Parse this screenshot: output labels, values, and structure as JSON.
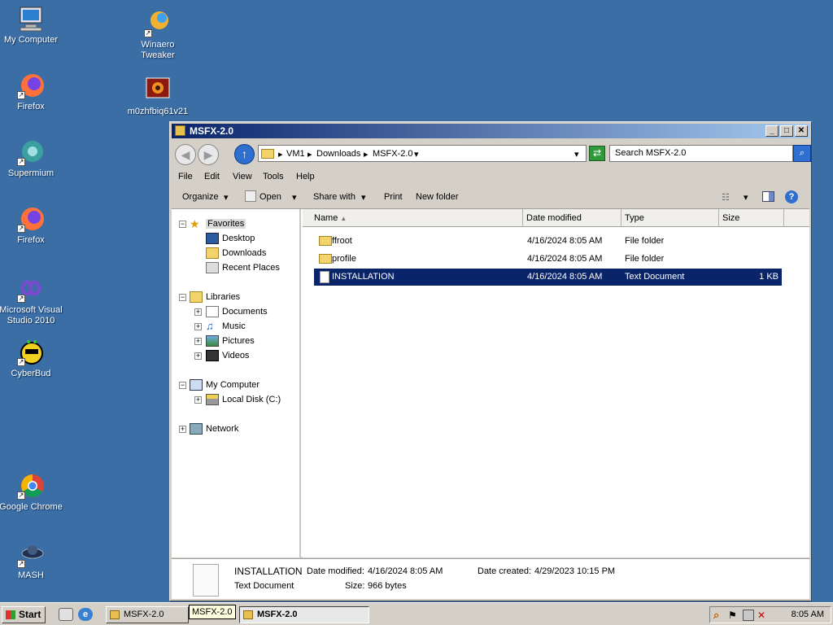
{
  "desktop": {
    "icons": [
      {
        "label": "My Computer"
      },
      {
        "label": "Winaero Tweaker"
      },
      {
        "label": "Firefox"
      },
      {
        "label": "m0zhfbiq61v21"
      },
      {
        "label": "Supermium"
      },
      {
        "label": "Firefox"
      },
      {
        "label": "Microsoft Visual Studio 2010"
      },
      {
        "label": "CyberBud"
      },
      {
        "label": "Google Chrome"
      },
      {
        "label": "MASH"
      }
    ]
  },
  "window": {
    "title": "MSFX-2.0",
    "address": {
      "crumbs": [
        "VM1",
        "Downloads",
        "MSFX-2.0"
      ],
      "separator": "▸"
    },
    "search_placeholder": "Search MSFX-2.0",
    "menu": [
      "File",
      "Edit",
      "View",
      "Tools",
      "Help"
    ],
    "toolbar": {
      "organize": "Organize",
      "open": "Open",
      "share": "Share with",
      "print": "Print",
      "new_folder": "New folder"
    },
    "nav": {
      "favorites": "Favorites",
      "desktop": "Desktop",
      "downloads": "Downloads",
      "recent": "Recent Places",
      "libraries": "Libraries",
      "documents": "Documents",
      "music": "Music",
      "pictures": "Pictures",
      "videos": "Videos",
      "computer": "My Computer",
      "localdisk": "Local Disk (C:)",
      "network": "Network"
    },
    "columns": {
      "name": "Name",
      "date": "Date modified",
      "type": "Type",
      "size": "Size"
    },
    "files": [
      {
        "name": "ffroot",
        "date": "4/16/2024 8:05 AM",
        "type": "File folder",
        "size": ""
      },
      {
        "name": "profile",
        "date": "4/16/2024 8:05 AM",
        "type": "File folder",
        "size": ""
      },
      {
        "name": "INSTALLATION",
        "date": "4/16/2024 8:05 AM",
        "type": "Text Document",
        "size": "1 KB"
      }
    ],
    "details": {
      "name": "INSTALLATION",
      "type": "Text Document",
      "modified_label": "Date modified:",
      "modified_value": "4/16/2024 8:05 AM",
      "created_label": "Date created:",
      "created_value": "4/29/2023 10:15 PM",
      "size_label": "Size:",
      "size_value": "966 bytes"
    }
  },
  "taskbar": {
    "start": "Start",
    "tasks": [
      "MSFX-2.0",
      "MSFX-2.0"
    ],
    "tooltip": "MSFX-2.0",
    "clock": "8:05 AM"
  }
}
